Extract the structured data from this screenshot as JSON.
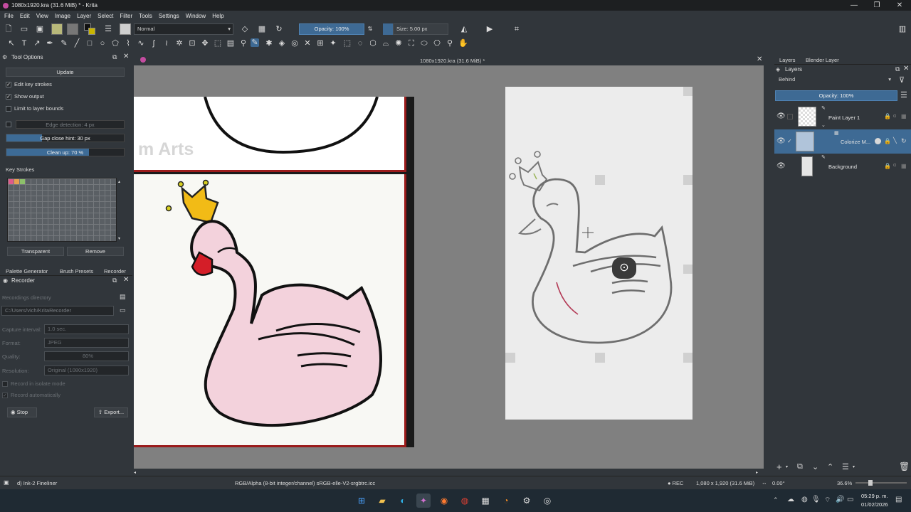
{
  "window": {
    "title": "1080x1920.kra (31.6 MiB) * - Krita"
  },
  "menu": [
    "File",
    "Edit",
    "View",
    "Image",
    "Layer",
    "Select",
    "Filter",
    "Tools",
    "Settings",
    "Window",
    "Help"
  ],
  "toolbar": {
    "blend_mode": "Normal",
    "opacity": "Opacity: 100%",
    "size": "Size: 5.00 px"
  },
  "tool_options": {
    "title": "Tool Options",
    "update_label": "Update",
    "edit_key_strokes": "Edit key strokes",
    "show_output": "Show output",
    "limit_to_layer_bounds": "Limit to layer bounds",
    "edge_detection": "Edge detection: 4 px",
    "gap_close_hint": "Gap close hint: 30 px",
    "gap_close_value": 0.3,
    "clean_up": "Clean up: 70 %",
    "clean_up_value": 0.7,
    "key_strokes_label": "Key Strokes",
    "key_stroke_colors": [
      "#e05a8a",
      "#e8a050",
      "#8cc06a"
    ],
    "transparent_label": "Transparent",
    "remove_label": "Remove"
  },
  "dock_tabs": [
    "Palette Generator",
    "Brush Presets",
    "Recorder"
  ],
  "recorder": {
    "title": "Recorder",
    "recordings_directory_label": "Recordings directory",
    "recordings_directory": "C:/Users/vich/KritaRecorder",
    "capture_interval_label": "Capture interval:",
    "capture_interval": "1.0 sec.",
    "format_label": "Format:",
    "format": "JPEG",
    "quality_label": "Quality:",
    "quality": "80%",
    "resolution_label": "Resolution:",
    "resolution": "Original (1080x1920)",
    "record_isolate": "Record in isolate mode",
    "record_auto": "Record automatically",
    "stop_label": "Stop",
    "export_label": "Export..."
  },
  "canvas": {
    "tab_title": "1080x1920.kra (31.6 MiB) *",
    "watermark": "m Arts"
  },
  "layers": {
    "tabs": [
      "Layers",
      "Blender Layer"
    ],
    "panel_title": "Layers",
    "blend": "Behind",
    "opacity": "Opacity: 100%",
    "items": [
      {
        "name": "Paint Layer 1"
      },
      {
        "name": "Colorize M..."
      },
      {
        "name": "Background"
      }
    ]
  },
  "status": {
    "brush": "d) Ink-2 Fineliner",
    "color_space": "RGB/Alpha (8-bit integer/channel)  sRGB-elle-V2-srgbtrc.icc",
    "rec": "● REC",
    "dims": "1,080 x 1,920 (31.6 MiB)",
    "rotation": "0.00°",
    "zoom": "36.6%"
  },
  "taskbar": {
    "time": "05:29 p. m.",
    "date": "01/02/2026"
  }
}
